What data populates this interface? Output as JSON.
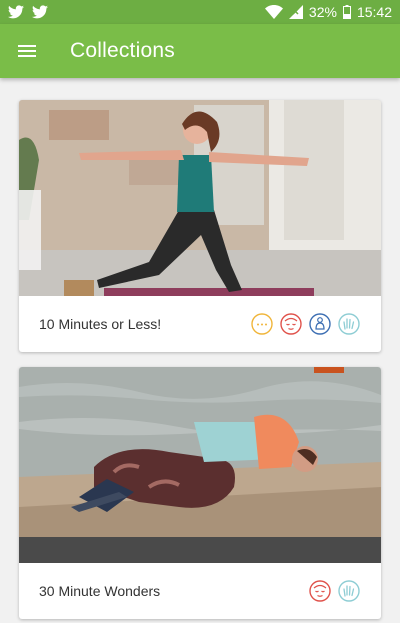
{
  "status": {
    "battery": "32%",
    "time": "15:42",
    "left_icons": [
      "twitter-icon",
      "twitter-icon"
    ],
    "right_icons": [
      "wifi-icon",
      "cell-signal-icon",
      "battery-icon"
    ]
  },
  "appbar": {
    "title": "Collections",
    "menu_icon": "hamburger-menu-icon"
  },
  "collections": [
    {
      "title": "10 Minutes or Less!",
      "icons": [
        "chat-bubble-icon",
        "relaxed-face-icon",
        "meditation-icon",
        "hand-wave-icon"
      ]
    },
    {
      "title": "30 Minute Wonders",
      "icons": [
        "relaxed-face-icon",
        "hand-wave-icon"
      ]
    }
  ],
  "colors": {
    "statusbar": "#6dae43",
    "appbar": "#7abd48",
    "chat": "#f0b53a",
    "face": "#e0524b",
    "meditation": "#3d6fb3",
    "hand": "#8ecdd4"
  }
}
